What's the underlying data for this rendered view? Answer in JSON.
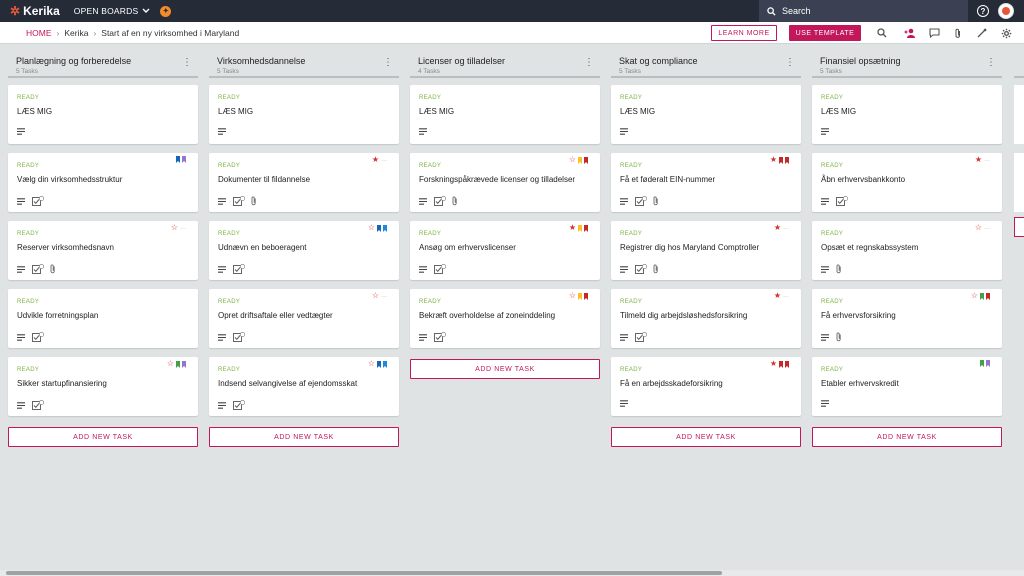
{
  "app": {
    "logo_text": "Kerika",
    "open_boards_label": "OPEN BOARDS",
    "search_placeholder": "Search"
  },
  "breadcrumb": {
    "home": "HOME",
    "org": "Kerika",
    "board": "Start af en ny virksomhed i Maryland"
  },
  "actions": {
    "learn_more": "LEARN MORE",
    "use_template": "USE TEMPLATE"
  },
  "colors": {
    "brand": "#c2185b",
    "topbar": "#262b38",
    "ready": "#7cb342"
  },
  "add_task_label": "ADD NEW TASK",
  "columns": [
    {
      "title": "Planlægning og forberedelse",
      "count": "5 Tasks",
      "cards": [
        {
          "status": "READY",
          "title": "LÆS MIG",
          "attach": false,
          "checklist": false,
          "star": "",
          "flags": []
        },
        {
          "status": "READY",
          "title": "Vælg din virksomhedsstruktur",
          "attach": false,
          "checklist": true,
          "star": "",
          "flags": [
            "#1565c0",
            "#9575cd"
          ]
        },
        {
          "status": "READY",
          "title": "Reserver virksomhedsnavn",
          "attach": true,
          "checklist": true,
          "star": "outline",
          "flags": []
        },
        {
          "status": "READY",
          "title": "Udvikle forretningsplan",
          "attach": false,
          "checklist": true,
          "star": "",
          "flags": []
        },
        {
          "status": "READY",
          "title": "Sikker startupfinansiering",
          "attach": false,
          "checklist": true,
          "star": "outline",
          "flags": [
            "#43a047",
            "#9575cd"
          ]
        }
      ]
    },
    {
      "title": "Virksomhedsdannelse",
      "count": "5 Tasks",
      "cards": [
        {
          "status": "READY",
          "title": "LÆS MIG",
          "attach": false,
          "checklist": false,
          "star": "",
          "flags": []
        },
        {
          "status": "READY",
          "title": "Dokumenter til fildannelse",
          "attach": true,
          "checklist": true,
          "star": "filled",
          "flags": []
        },
        {
          "status": "READY",
          "title": "Udnævn en beboeragent",
          "attach": false,
          "checklist": true,
          "star": "outline",
          "flags": [
            "#1565c0",
            "#1e88e5"
          ]
        },
        {
          "status": "READY",
          "title": "Opret driftsaftale eller vedtægter",
          "attach": false,
          "checklist": true,
          "star": "outline",
          "flags": []
        },
        {
          "status": "READY",
          "title": "Indsend selvangivelse af ejendomsskat",
          "attach": false,
          "checklist": true,
          "star": "outline",
          "flags": [
            "#1565c0",
            "#1e88e5"
          ]
        }
      ]
    },
    {
      "title": "Licenser og tilladelser",
      "count": "4 Tasks",
      "cards": [
        {
          "status": "READY",
          "title": "LÆS MIG",
          "attach": false,
          "checklist": false,
          "star": "",
          "flags": []
        },
        {
          "status": "READY",
          "title": "Forskningspåkrævede licenser og tilladelser",
          "attach": true,
          "checklist": true,
          "star": "outline",
          "flags": [
            "#fbc02d",
            "#c62828"
          ]
        },
        {
          "status": "READY",
          "title": "Ansøg om erhvervslicenser",
          "attach": false,
          "checklist": true,
          "star": "filled",
          "flags": [
            "#fbc02d",
            "#c62828"
          ]
        },
        {
          "status": "READY",
          "title": "Bekræft overholdelse af zoneinddeling",
          "attach": false,
          "checklist": true,
          "star": "outline",
          "flags": [
            "#fbc02d",
            "#c62828"
          ]
        }
      ]
    },
    {
      "title": "Skat og compliance",
      "count": "5 Tasks",
      "cards": [
        {
          "status": "READY",
          "title": "LÆS MIG",
          "attach": false,
          "checklist": false,
          "star": "",
          "flags": []
        },
        {
          "status": "READY",
          "title": "Få et føderalt EIN-nummer",
          "attach": true,
          "checklist": true,
          "star": "filled",
          "flags": [
            "#c62828",
            "#c62828"
          ]
        },
        {
          "status": "READY",
          "title": "Registrer dig hos Maryland Comptroller",
          "attach": true,
          "checklist": true,
          "star": "filled",
          "flags": []
        },
        {
          "status": "READY",
          "title": "Tilmeld dig arbejdsløshedsforsikring",
          "attach": false,
          "checklist": true,
          "star": "filled",
          "flags": []
        },
        {
          "status": "READY",
          "title": "Få en arbejdsskadeforsikring",
          "attach": false,
          "checklist": false,
          "star": "filled",
          "flags": [
            "#c62828",
            "#c62828"
          ]
        }
      ]
    },
    {
      "title": "Finansiel opsætning",
      "count": "5 Tasks",
      "cards": [
        {
          "status": "READY",
          "title": "LÆS MIG",
          "attach": false,
          "checklist": false,
          "star": "",
          "flags": []
        },
        {
          "status": "READY",
          "title": "Åbn erhvervsbankkonto",
          "attach": false,
          "checklist": true,
          "star": "filled",
          "flags": []
        },
        {
          "status": "READY",
          "title": "Opsæt et regnskabssystem",
          "attach": true,
          "checklist": false,
          "star": "outline",
          "flags": []
        },
        {
          "status": "READY",
          "title": "Få erhvervsforsikring",
          "attach": true,
          "checklist": false,
          "star": "outline",
          "flags": [
            "#43a047",
            "#c62828"
          ]
        },
        {
          "status": "READY",
          "title": "Etabler erhvervskredit",
          "attach": false,
          "checklist": false,
          "star": "",
          "flags": [
            "#43a047",
            "#9575cd"
          ]
        }
      ]
    }
  ]
}
